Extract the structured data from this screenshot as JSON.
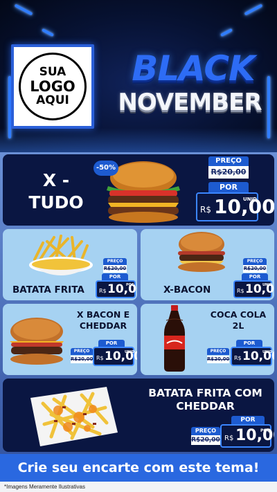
{
  "header": {
    "logo": {
      "line1": "SUA",
      "line2": "LOGO",
      "line3": "AQUI"
    },
    "title_line1": "BLACK",
    "title_line2": "NOVEMBER"
  },
  "colors": {
    "accent_blue": "#1d5bd0",
    "card_dark": "#0a1642",
    "card_light": "#a6d2f2",
    "cta_blue": "#2a68e0"
  },
  "products": [
    {
      "name_lines": [
        "X -",
        "TUDO"
      ],
      "discount_badge": "-50%",
      "icon": "burger-deluxe-icon",
      "price_label": "PREÇO",
      "old_price": "R$20,00",
      "new_price_label": "POR",
      "currency": "R$",
      "new_price": "10,00",
      "unit": "UNID"
    },
    {
      "name": "BATATA FRITA",
      "icon": "french-fries-icon",
      "price_label": "PREÇO",
      "old_price": "R$20,00",
      "new_price_label": "POR",
      "currency": "R$",
      "new_price": "10,00",
      "unit": "POÇ"
    },
    {
      "name": "X-BACON",
      "icon": "bacon-burger-icon",
      "price_label": "PREÇO",
      "old_price": "R$20,00",
      "new_price_label": "POR",
      "currency": "R$",
      "new_price": "10,00",
      "unit": "UNID"
    },
    {
      "name_lines": [
        "X BACON E",
        "CHEDDAR"
      ],
      "icon": "cheddar-burger-icon",
      "price_label": "PREÇO",
      "old_price": "R$20,00",
      "new_price_label": "POR",
      "currency": "R$",
      "new_price": "10,00",
      "unit": "UNID"
    },
    {
      "name_lines": [
        "COCA COLA",
        "2L"
      ],
      "icon": "cola-bottle-icon",
      "price_label": "PREÇO",
      "old_price": "R$20,00",
      "new_price_label": "POR",
      "currency": "R$",
      "new_price": "10,00",
      "unit": "UNID"
    },
    {
      "name_lines": [
        "BATATA FRITA COM",
        "CHEDDAR"
      ],
      "icon": "cheddar-fries-icon",
      "price_label": "PREÇO",
      "old_price": "R$20,00",
      "new_price_label": "POR",
      "currency": "R$",
      "new_price": "10,00",
      "unit": "POÇ"
    }
  ],
  "cta": "Crie seu encarte com este tema!",
  "disclaimer": "*Imagens Meramente Ilustrativas"
}
